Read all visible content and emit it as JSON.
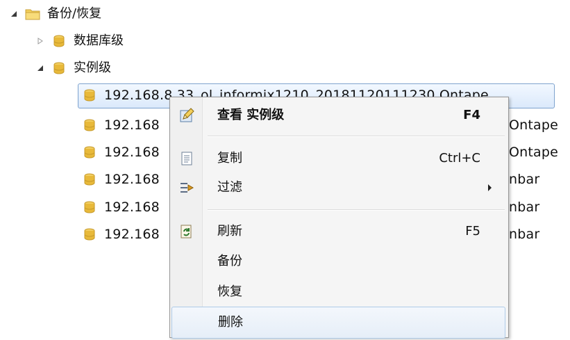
{
  "tree": {
    "root": {
      "label": "备份/恢复",
      "expanded": true,
      "icon": "folder-icon"
    },
    "children": [
      {
        "label": "数据库级",
        "expanded": false,
        "icon": "database-icon"
      },
      {
        "label": "实例级",
        "expanded": true,
        "icon": "database-icon"
      }
    ],
    "instances": [
      {
        "label": "192.168.8.33_ol_informix1210_20181120111230 Ontape",
        "selected": true
      },
      {
        "label": "192.168",
        "suffix": "Ontape"
      },
      {
        "label": "192.168",
        "suffix": "Ontape"
      },
      {
        "label": "192.168",
        "suffix": "nbar"
      },
      {
        "label": "192.168",
        "suffix": "nbar"
      },
      {
        "label": "192.168",
        "suffix": "nbar"
      }
    ]
  },
  "context_menu": {
    "items": [
      {
        "label": "查看 实例级",
        "shortcut": "F4",
        "icon": "edit-icon",
        "bold": true
      },
      {
        "label": "复制",
        "shortcut": "Ctrl+C",
        "icon": "copy-icon"
      },
      {
        "label": "过滤",
        "submenu": true,
        "icon": "filter-icon"
      },
      {
        "label": "刷新",
        "shortcut": "F5",
        "icon": "refresh-icon"
      },
      {
        "label": "备份"
      },
      {
        "label": "恢复"
      },
      {
        "label": "删除",
        "hover": true
      }
    ]
  },
  "colors": {
    "selection_border": "#7da2ce",
    "db_icon": "#e8b93a",
    "folder_icon": "#f3cf5b"
  }
}
